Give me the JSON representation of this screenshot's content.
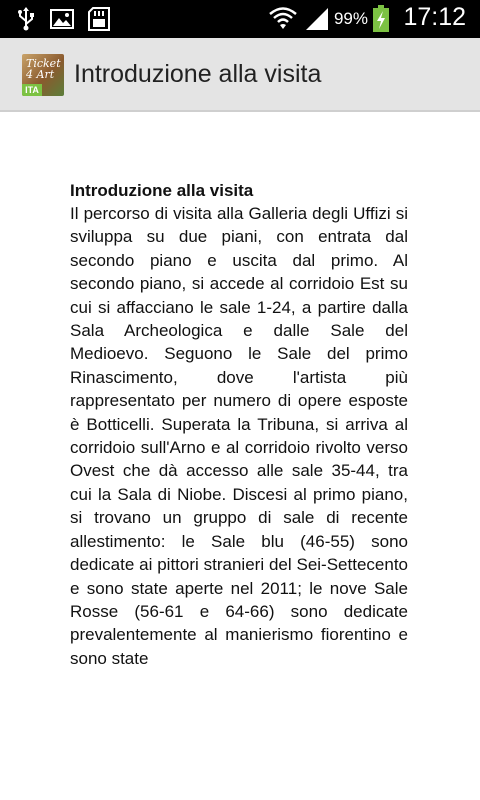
{
  "status_bar": {
    "icons": [
      "usb-icon",
      "image-icon",
      "sd-card-icon",
      "wifi-icon",
      "signal-icon",
      "battery-charging-icon"
    ],
    "battery_percent": "99%",
    "time": "17:12",
    "battery_color": "#7cc243"
  },
  "action_bar": {
    "logo_text": "Ticket 4 Art",
    "logo_tag": "ITA",
    "title": "Introduzione alla visita"
  },
  "content": {
    "heading": "Introduzione alla visita",
    "body": "Il percorso di visita alla Galleria degli Uffizi si sviluppa su due piani, con entrata dal secondo piano e uscita dal primo. Al secondo piano, si accede al corridoio Est su cui si affacciano le sale 1-24, a partire dalla Sala Archeologica e dalle Sale del Medioevo. Seguono le Sale del primo Rinascimento, dove l'artista più rappresentato per numero di opere esposte è Botticelli. Superata la Tribuna, si arriva al corridoio sull'Arno e al corridoio rivolto verso Ovest che dà accesso alle sale 35-44, tra cui la Sala di Niobe. Discesi al primo piano, si trovano un gruppo di sale di recente allestimento: le Sale blu (46-55) sono dedicate ai pittori stranieri del Sei-Settecento e sono state aperte nel 2011; le nove Sale Rosse (56-61 e 64-66) sono dedicate prevalentemente al manierismo fiorentino e sono state"
  }
}
